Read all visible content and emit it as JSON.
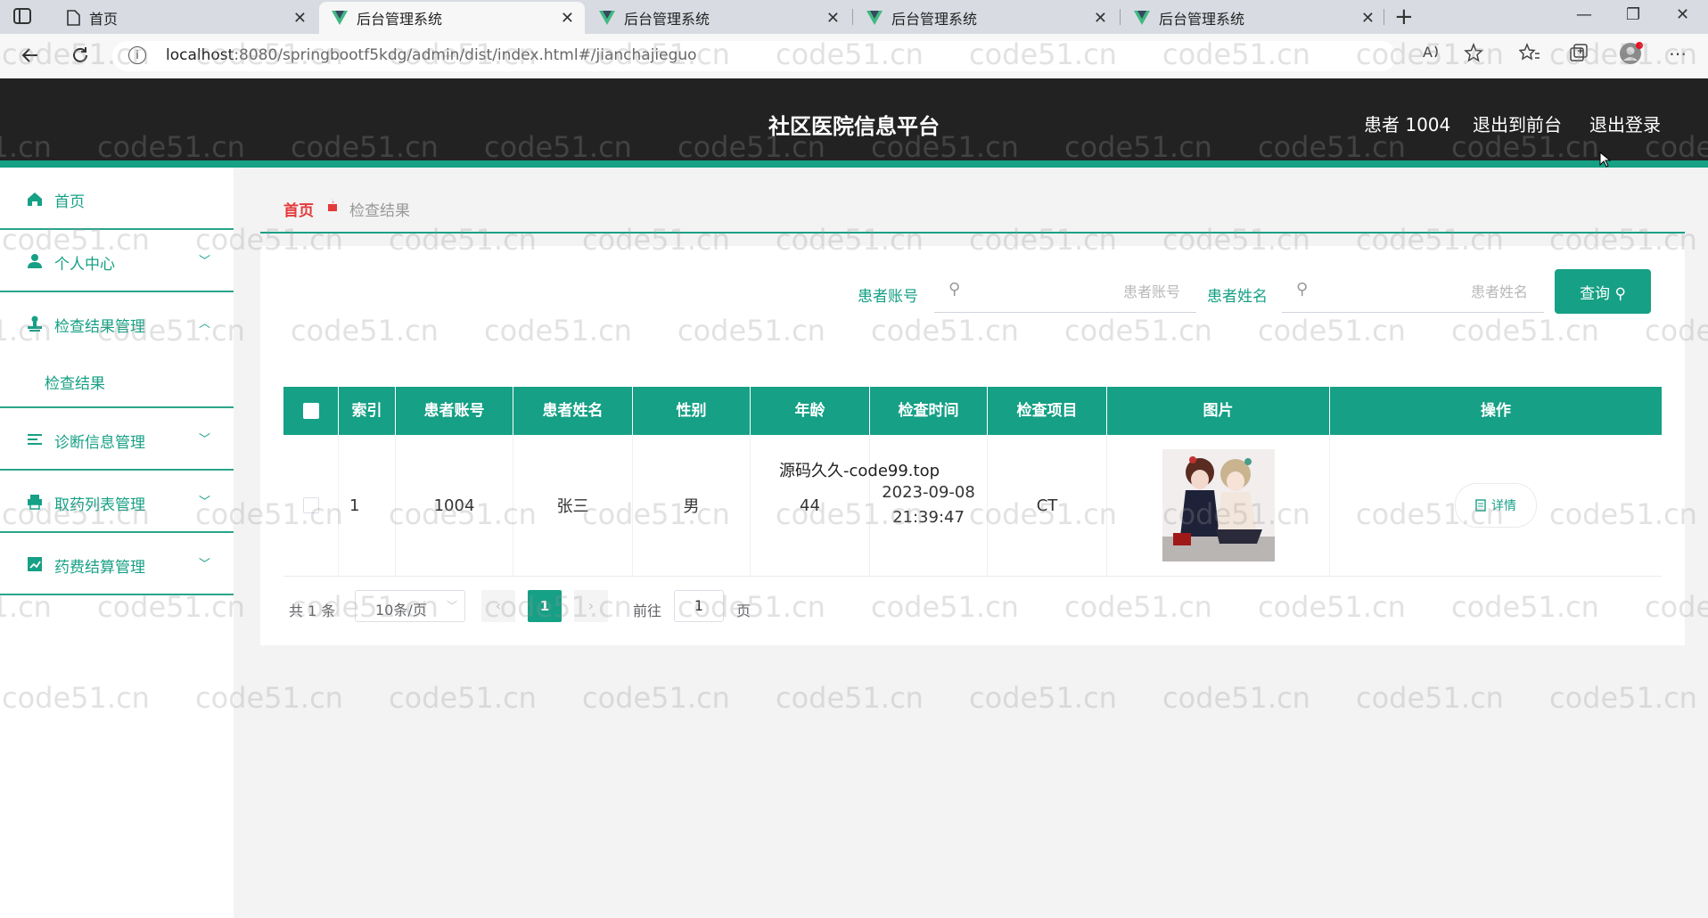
{
  "browser": {
    "tabs": [
      {
        "title": "首页",
        "icon": "page-icon"
      },
      {
        "title": "后台管理系统",
        "icon": "vue-logo-icon"
      },
      {
        "title": "后台管理系统",
        "icon": "vue-logo-icon"
      },
      {
        "title": "后台管理系统",
        "icon": "vue-logo-icon"
      },
      {
        "title": "后台管理系统",
        "icon": "vue-logo-icon"
      }
    ],
    "active_tab": 1,
    "url_host": "localhost",
    "url_rest": ":8080/springbootf5kdg/admin/dist/index.html#/jianchajieguo"
  },
  "header": {
    "title": "社区医院信息平台",
    "user": "患者 1004",
    "to_front": "退出到前台",
    "logout": "退出登录",
    "accent": "#16a085"
  },
  "sidebar": {
    "items": [
      {
        "label": "首页",
        "icon": "home-icon"
      },
      {
        "label": "个人中心",
        "icon": "user-icon"
      },
      {
        "label": "检查结果管理",
        "icon": "stamp-icon"
      },
      {
        "label": "检查结果"
      },
      {
        "label": "诊断信息管理",
        "icon": "list-icon"
      },
      {
        "label": "取药列表管理",
        "icon": "printer-icon"
      },
      {
        "label": "药费结算管理",
        "icon": "chart-icon"
      }
    ]
  },
  "breadcrumb": {
    "home": "首页",
    "current": "检查结果"
  },
  "search": {
    "account_label": "患者账号",
    "account_placeholder": "患者账号",
    "name_label": "患者姓名",
    "name_placeholder": "患者姓名",
    "button": "查询"
  },
  "table": {
    "columns": [
      "索引",
      "患者账号",
      "患者姓名",
      "性别",
      "年龄",
      "检查时间",
      "检查项目",
      "图片",
      "操作"
    ],
    "rows": [
      {
        "index": "1",
        "account": "1004",
        "name": "张三",
        "gender": "男",
        "age": "44",
        "time_date": "2023-09-08",
        "time_clock": "21:39:47",
        "item": "CT",
        "action": "详情"
      }
    ]
  },
  "overlay_text": "源码久久-code99.top",
  "pagination": {
    "total": "共 1 条",
    "page_size": "10条/页",
    "current_page": "1",
    "goto_label": "前往",
    "goto_value": "1",
    "goto_suffix": "页"
  },
  "watermark": "code51.cn"
}
